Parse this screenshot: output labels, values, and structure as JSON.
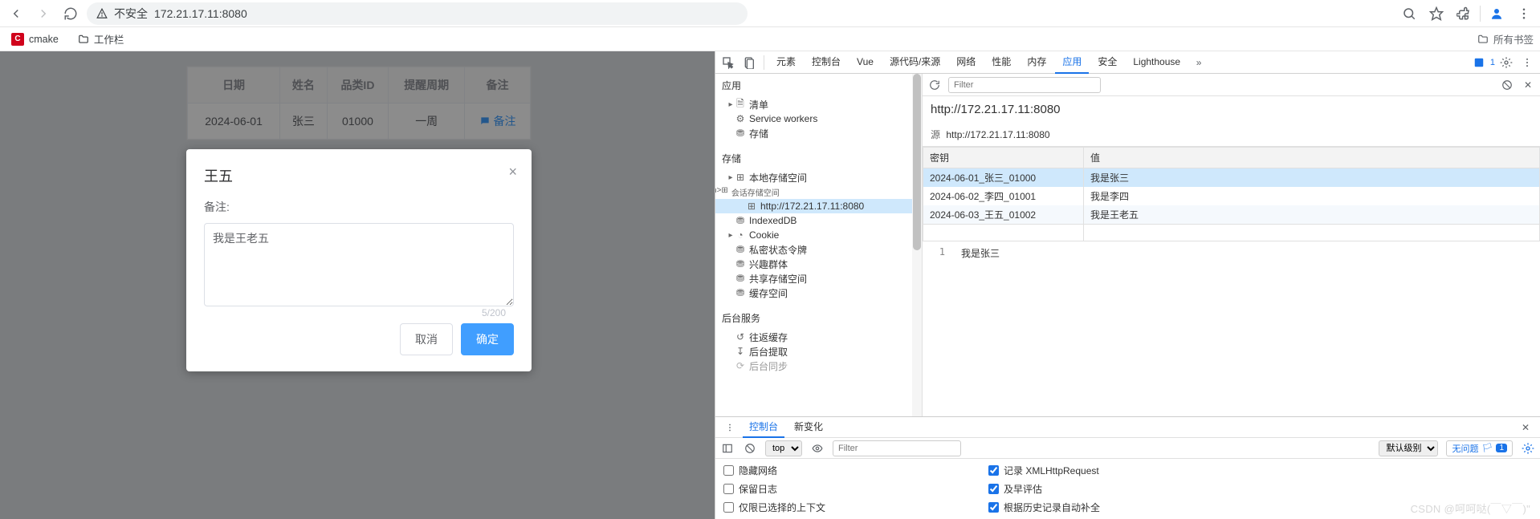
{
  "chrome": {
    "url": "172.21.17.11:8080",
    "insecure": "不安全",
    "bookmarks": {
      "cmake": "cmake",
      "workbar": "工作栏",
      "all": "所有书签"
    }
  },
  "page": {
    "headers": [
      "日期",
      "姓名",
      "品类ID",
      "提醒周期",
      "备注"
    ],
    "row": {
      "date": "2024-06-01",
      "name": "张三",
      "sku": "01000",
      "cycle": "一周",
      "remark_label": "备注"
    },
    "modal": {
      "title": "王五",
      "label": "备注:",
      "text": "我是王老五",
      "count": "5/200",
      "cancel": "取消",
      "confirm": "确定"
    }
  },
  "devtools": {
    "tabs": {
      "elements": "元素",
      "console": "控制台",
      "vue": "Vue",
      "sources": "源代码/来源",
      "network": "网络",
      "performance": "性能",
      "memory": "内存",
      "application": "应用",
      "security": "安全",
      "lighthouse": "Lighthouse"
    },
    "badge_count": "1",
    "left": {
      "app": "应用",
      "manifest": "清单",
      "sw": "Service workers",
      "storage_root": "存储",
      "storage_section": "存储",
      "local": "本地存储空间",
      "session": "会话存储空间",
      "session_origin": "http://172.21.17.11:8080",
      "indexeddb": "IndexedDB",
      "cookie": "Cookie",
      "private_token": "私密状态令牌",
      "interest": "兴趣群体",
      "shared": "共享存储空间",
      "cache": "缓存空间",
      "bg_section": "后台服务",
      "bfcache": "往返缓存",
      "bg_fetch": "后台提取",
      "bg_sync": "后台同步"
    },
    "right": {
      "filter_placeholder": "Filter",
      "title": "http://172.21.17.11:8080",
      "origin_label": "源",
      "origin_value": "http://172.21.17.11:8080",
      "key_h": "密钥",
      "val_h": "值",
      "rows": [
        {
          "k": "2024-06-01_张三_01000",
          "v": "我是张三"
        },
        {
          "k": "2024-06-02_李四_01001",
          "v": "我是李四"
        },
        {
          "k": "2024-06-03_王五_01002",
          "v": "我是王老五"
        }
      ],
      "detail_ln": "1",
      "detail_val": "我是张三"
    },
    "drawer": {
      "console_tab": "控制台",
      "whatsnew_tab": "新变化",
      "top": "top",
      "filter_placeholder": "Filter",
      "level": "默认级别",
      "issues": "无问题",
      "issue_count": "1",
      "checks": {
        "hide_network": "隐藏网络",
        "log_xhr": "记录 XMLHttpRequest",
        "preserve": "保留日志",
        "eager": "及早评估",
        "context": "仅限已选择的上下文",
        "autocomplete": "根据历史记录自动补全"
      }
    }
  },
  "watermark": "CSDN @呵呵哒(￣▽￣)\""
}
